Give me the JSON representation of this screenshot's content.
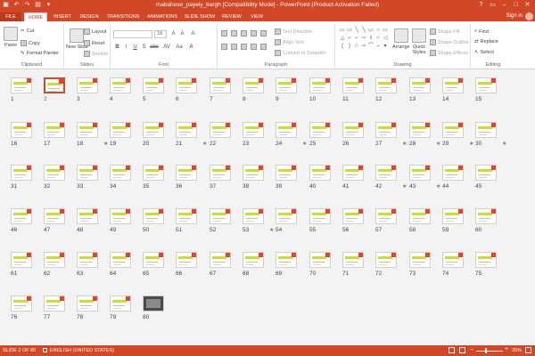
{
  "window": {
    "title": "mabahese_payeiy_bargh [Compatibility Mode] - PowerPoint (Product Activation Failed)",
    "quick_access": [
      "save-icon",
      "undo-icon",
      "redo-icon",
      "start-icon",
      "customize-icon"
    ],
    "controls": [
      "?",
      "▭",
      "–",
      "□",
      "✕"
    ]
  },
  "tabs": [
    {
      "label": "FILE"
    },
    {
      "label": "HOME"
    },
    {
      "label": "INSERT"
    },
    {
      "label": "DESIGN"
    },
    {
      "label": "TRANSITIONS"
    },
    {
      "label": "ANIMATIONS"
    },
    {
      "label": "SLIDE SHOW"
    },
    {
      "label": "REVIEW"
    },
    {
      "label": "VIEW"
    }
  ],
  "account": {
    "signin": "Sign in"
  },
  "ribbon": {
    "clipboard": {
      "label": "Clipboard",
      "paste": "Paste",
      "cut": "Cut",
      "copy": "Copy",
      "format_painter": "Format Painter"
    },
    "slides": {
      "label": "Slides",
      "new_slide": "New Slide",
      "layout": "Layout",
      "reset": "Reset",
      "section": "Section"
    },
    "font": {
      "label": "Font",
      "size": "18",
      "bold": "B",
      "italic": "I",
      "underline": "U",
      "strike": "S",
      "abc": "abc",
      "spacing": "AV",
      "case": "Aa",
      "color": "A",
      "grow": "A",
      "shrink": "A",
      "clear": "A"
    },
    "paragraph": {
      "label": "Paragraph",
      "text_direction": "Text Direction",
      "align_text": "Align Text",
      "convert": "Convert to SmartArt"
    },
    "drawing": {
      "label": "Drawing",
      "arrange": "Arrange",
      "quick_styles": "Quick Styles",
      "shape_fill": "Shape Fill",
      "shape_outline": "Shape Outline",
      "shape_effects": "Shape Effects",
      "shapes": [
        "▭",
        "▭",
        "╲",
        "╲",
        "▭",
        "○",
        "▭",
        "△",
        "⌐",
        "⌐",
        "⇨",
        "⇩",
        "☆",
        "◁",
        "{",
        "}",
        "☆",
        "⇨",
        "⌒",
        "⌣",
        "▾"
      ]
    },
    "editing": {
      "label": "Editing",
      "find": "Find",
      "replace": "Replace",
      "select": "Select"
    }
  },
  "slides": {
    "total": 80,
    "selected": 2,
    "photo": [
      80
    ],
    "starred": [
      18,
      21,
      24,
      27,
      28,
      29,
      30,
      42,
      43,
      53
    ],
    "star_glyph": "★",
    "numbers": [
      "1",
      "2",
      "3",
      "4",
      "5",
      "6",
      "7",
      "8",
      "9",
      "10",
      "11",
      "12",
      "13",
      "14",
      "15",
      "16",
      "17",
      "18",
      "19",
      "20",
      "21",
      "22",
      "23",
      "24",
      "25",
      "26",
      "27",
      "28",
      "29",
      "30",
      "31",
      "32",
      "33",
      "34",
      "35",
      "36",
      "37",
      "38",
      "39",
      "40",
      "41",
      "42",
      "43",
      "44",
      "45",
      "46",
      "47",
      "48",
      "49",
      "50",
      "51",
      "52",
      "53",
      "54",
      "55",
      "56",
      "57",
      "58",
      "59",
      "60",
      "61",
      "62",
      "63",
      "64",
      "65",
      "66",
      "67",
      "68",
      "69",
      "70",
      "71",
      "72",
      "73",
      "74",
      "75",
      "76",
      "77",
      "78",
      "79",
      "80"
    ]
  },
  "status": {
    "slide": "SLIDE 2 OF 80",
    "language": "ENGLISH (UNITED STATES)",
    "zoom_minus": "–",
    "zoom_plus": "+",
    "zoom": "20%",
    "zoom_level": 0.2
  },
  "colors": {
    "accent": "#d24726",
    "thumb_band": "#c8df2e",
    "thumb_corner": "#e8402a"
  }
}
